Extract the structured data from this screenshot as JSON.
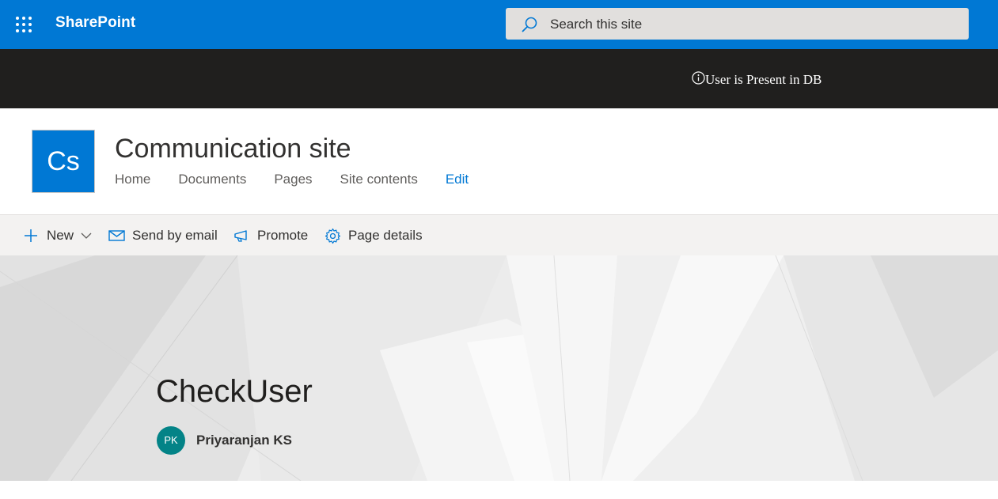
{
  "suite_bar": {
    "brand": "SharePoint",
    "search_placeholder": "Search this site",
    "background_color": "#0078d4"
  },
  "notification": {
    "icon": "info-icon",
    "text": "User is Present in DB",
    "background_color": "#201f1e"
  },
  "site": {
    "logo_initials": "Cs",
    "title": "Communication site",
    "nav": {
      "home": "Home",
      "documents": "Documents",
      "pages": "Pages",
      "site_contents": "Site contents",
      "edit": "Edit"
    },
    "accent_color": "#0078d4"
  },
  "command_bar": {
    "new": "New",
    "send_by_email": "Send by email",
    "promote": "Promote",
    "page_details": "Page details"
  },
  "page": {
    "title": "CheckUser",
    "author_initials": "PK",
    "author_name": "Priyaranjan KS",
    "avatar_color": "#038387"
  }
}
